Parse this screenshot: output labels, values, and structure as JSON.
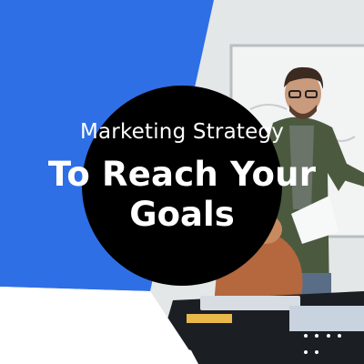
{
  "graphic": {
    "subtitle": "Marketing Strategy",
    "headline_line1": "To Reach Your",
    "headline_line2": "Goals"
  },
  "colors": {
    "accent_blue": "#2f6fe6",
    "circle": "#000000",
    "text": "#ffffff",
    "photo_wall": "#dfe4e6"
  },
  "decorations": {
    "dot_count": 6
  }
}
